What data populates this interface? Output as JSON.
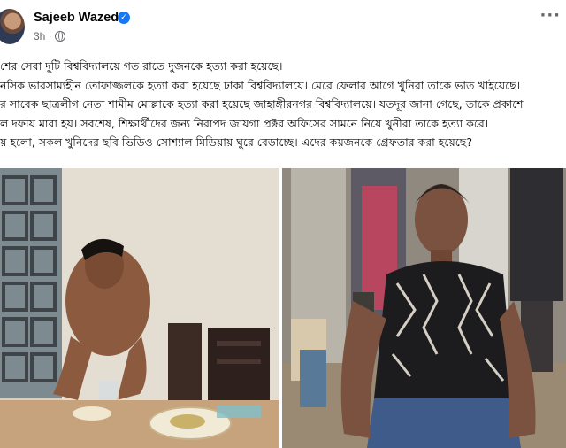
{
  "post": {
    "author": "Sajeeb Wazed",
    "time": "3h ·",
    "more_label": "···",
    "lines": [
      "শের সেরা দুটি বিশ্ববিদ্যালয়ে গত রাতে দুজনকে হত্যা করা হয়েছে।",
      "নসিক ভারসাম্যহীন তোফাজ্জলকে হত্যা করা হয়েছে ঢাকা বিশ্ববিদ্যালয়ে। মেরে ফেলার আগে খুনিরা তাকে ভাত খাইয়েছে।",
      "র সাবেক ছাত্রলীগ নেতা শামীম মোল্লাকে হত্যা করা হয়েছে জাহাঙ্গীরনগর বিশ্ববিদ্যালয়ে। যতদূর জানা গেছে, তাকে প্রকাশে",
      "ল দফায় মারা হয়। সবশেষ, শিক্ষার্থীদের জন্য নিরাপদ জায়গা প্রক্টর অফিসের সামনে নিয়ে খুনীরা তাকে হত্যা করে।",
      "য় হলো, সকল খুনিদের ছবি ভিডিও সোশ্যাল মিডিয়ায় ঘুরে  বেড়াচ্ছে। এদের কয়জনকে গ্রেফতার করা হয়েছে?"
    ]
  },
  "colors": {
    "verified": "#1877f2",
    "meta": "#65676b",
    "text": "#050505"
  }
}
